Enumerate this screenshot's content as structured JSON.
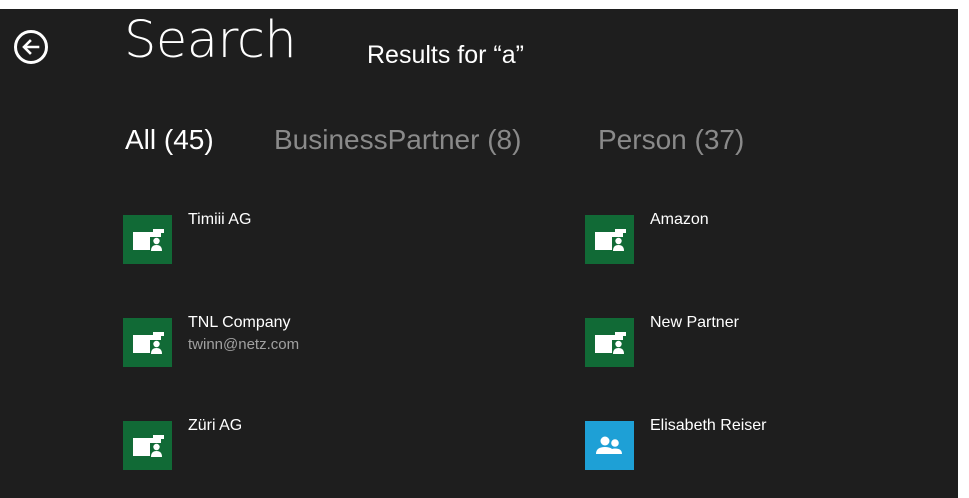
{
  "header": {
    "back_icon": "back-arrow-circle-icon",
    "title": "Search",
    "subtitle": "Results for “a”"
  },
  "filters": [
    {
      "label": "All (45)",
      "active": true
    },
    {
      "label": "BusinessPartner (8)",
      "active": false
    },
    {
      "label": "Person (37)",
      "active": false
    }
  ],
  "results": [
    {
      "name": "Timiii AG",
      "detail": "",
      "type": "business-partner",
      "icon": "business-partner-icon"
    },
    {
      "name": "Amazon",
      "detail": "",
      "type": "business-partner",
      "icon": "business-partner-icon"
    },
    {
      "name": "TNL Company",
      "detail": "twinn@netz.com",
      "type": "business-partner",
      "icon": "business-partner-icon"
    },
    {
      "name": "New Partner",
      "detail": "",
      "type": "business-partner",
      "icon": "business-partner-icon"
    },
    {
      "name": "Züri AG",
      "detail": "",
      "type": "business-partner",
      "icon": "business-partner-icon"
    },
    {
      "name": "Elisabeth Reiser",
      "detail": "",
      "type": "person",
      "icon": "person-group-icon"
    }
  ],
  "colors": {
    "background": "#1e1e1e",
    "business_partner_tile": "#116a36",
    "person_tile": "#1ea0d6",
    "inactive_filter": "#8a8a8a"
  }
}
